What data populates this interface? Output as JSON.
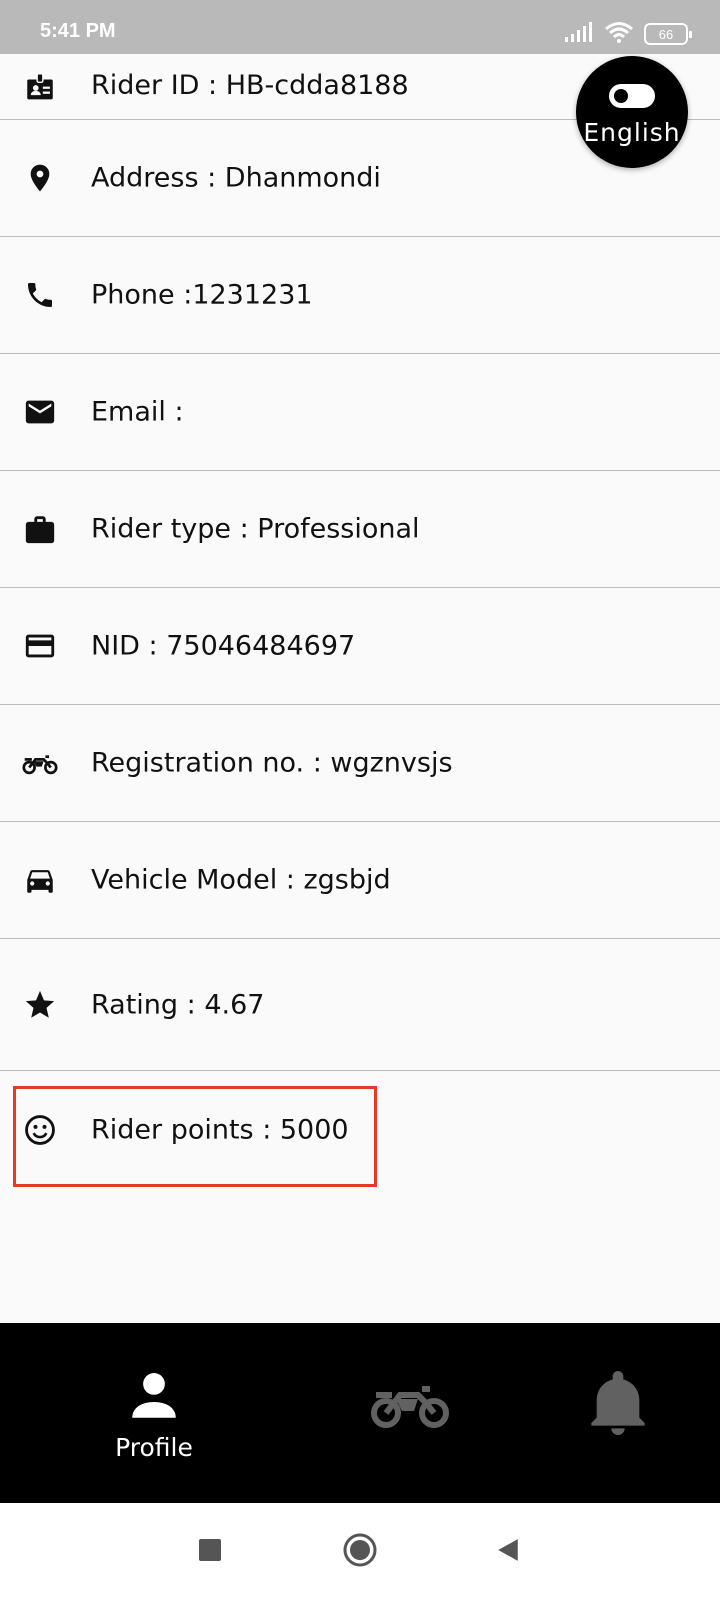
{
  "status_bar": {
    "time": "5:41 PM",
    "battery": "66",
    "icons": [
      "signal-icon",
      "wifi-icon",
      "battery-icon"
    ]
  },
  "language_toggle": {
    "label": "English",
    "icon": "toggle-icon"
  },
  "profile_rows": [
    {
      "icon": "id-badge-icon",
      "text": "Rider ID : HB-cdda8188"
    },
    {
      "icon": "location-pin-icon",
      "text": "Address : Dhanmondi"
    },
    {
      "icon": "phone-icon",
      "text": "Phone :1231231"
    },
    {
      "icon": "email-icon",
      "text": "Email :"
    },
    {
      "icon": "briefcase-icon",
      "text": "Rider type : Professional"
    },
    {
      "icon": "credit-card-icon",
      "text": "NID : 75046484697"
    },
    {
      "icon": "motorcycle-icon",
      "text": "Registration no. : wgznvsjs"
    },
    {
      "icon": "car-icon",
      "text": "Vehicle Model : zgsbjd"
    },
    {
      "icon": "star-icon",
      "text": "Rating : 4.67"
    },
    {
      "icon": "smiley-icon",
      "text": "Rider points : 5000"
    }
  ],
  "highlight": {
    "color": "#e53b24",
    "target": "Rider points : 5000"
  },
  "bottom_nav": {
    "items": [
      {
        "icon": "person-icon",
        "label": "Profile",
        "active": true
      },
      {
        "icon": "motorcycle-icon",
        "label": "",
        "active": false
      },
      {
        "icon": "bell-icon",
        "label": "",
        "active": false
      }
    ],
    "active_color": "#ffffff",
    "inactive_color": "#616161"
  },
  "system_nav": [
    "recents-square-icon",
    "home-circle-icon",
    "back-triangle-icon"
  ]
}
